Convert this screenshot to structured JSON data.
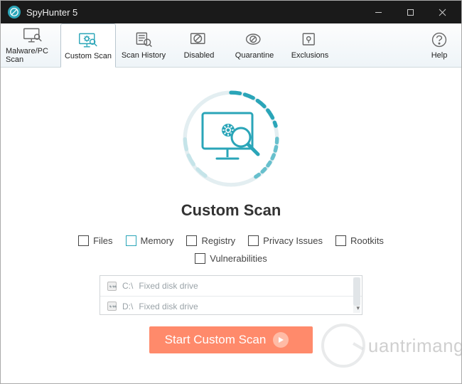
{
  "window": {
    "title": "SpyHunter 5"
  },
  "toolbar": {
    "items": [
      {
        "label": "Malware/PC Scan"
      },
      {
        "label": "Custom Scan"
      },
      {
        "label": "Scan History"
      },
      {
        "label": "Disabled"
      },
      {
        "label": "Quarantine"
      },
      {
        "label": "Exclusions"
      }
    ],
    "help": "Help"
  },
  "main": {
    "heading": "Custom Scan",
    "checks": {
      "files": "Files",
      "memory": "Memory",
      "registry": "Registry",
      "privacy": "Privacy Issues",
      "rootkits": "Rootkits",
      "vulnerabilities": "Vulnerabilities"
    },
    "drives": [
      {
        "letter": "C:\\",
        "desc": "Fixed disk drive"
      },
      {
        "letter": "D:\\",
        "desc": "Fixed disk drive"
      }
    ],
    "start_label": "Start Custom Scan"
  },
  "watermark": "uantrimang"
}
